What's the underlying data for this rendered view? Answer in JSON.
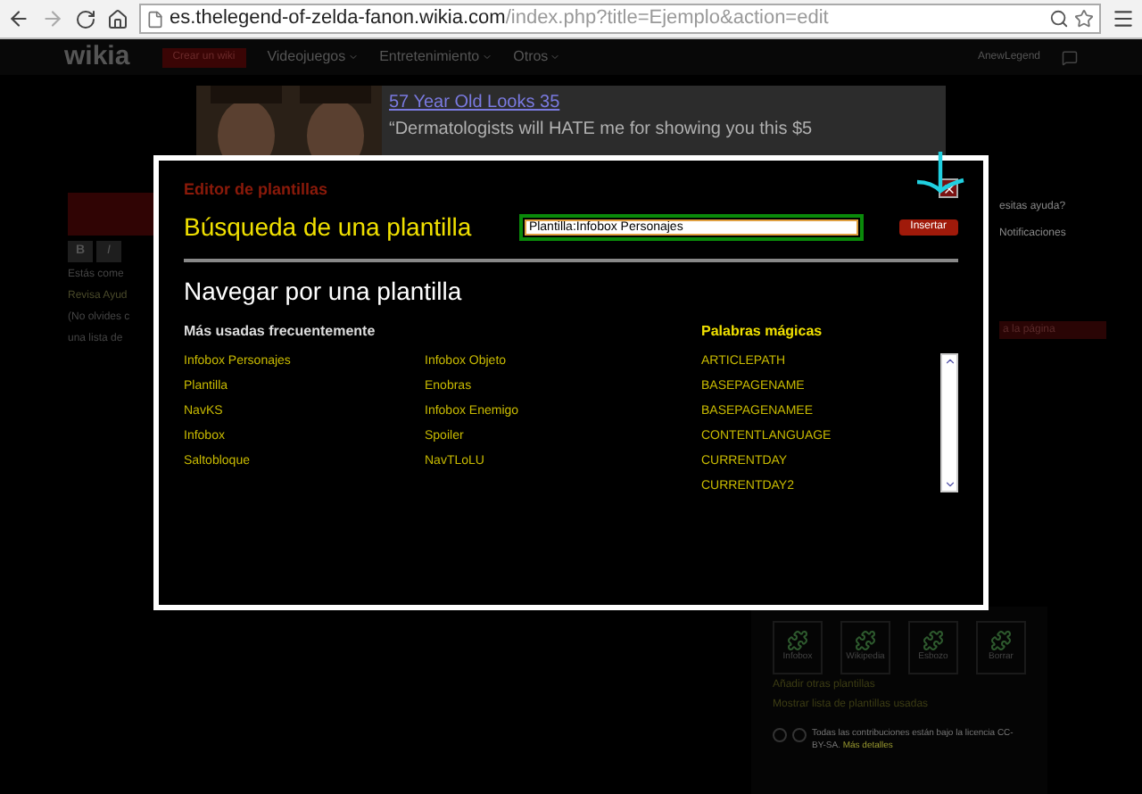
{
  "browser": {
    "url_host": "es.thelegend-of-zelda-fanon.wikia.com",
    "url_path": "/index.php?title=Ejemplo&action=edit"
  },
  "nav": {
    "logo": "wikia",
    "create": "Crear un wiki",
    "menus": [
      "Videojuegos",
      "Entretenimiento",
      "Otros"
    ],
    "user": "AnewLegend"
  },
  "ad": {
    "headline": "57 Year Old Looks 35",
    "text": "“Dermatologists will HATE me for showing you this $5"
  },
  "editor": {
    "toolbar": [
      "B",
      "I"
    ],
    "notes": [
      "Estás come",
      "Revisa Ayud",
      "(No olvides c",
      "una lista de"
    ]
  },
  "side": {
    "help": "esitas ayuda?",
    "notifications": "Notificaciones",
    "page_button": "a la página",
    "templates": [
      "Infobox",
      "Wikipedia",
      "Esbozo",
      "Borrar"
    ],
    "links": [
      "Añadir otras plantillas",
      "Mostrar lista de plantillas usadas"
    ],
    "license": "Todas las contribuciones están bajo la licencia CC-BY-SA.",
    "license_link": "Más detalles"
  },
  "dialog": {
    "title": "Editor de plantillas",
    "search_label": "Búsqueda de una plantilla",
    "search_value": "Plantilla:Infobox Personajes",
    "insert": "Insertar",
    "browse_title": "Navegar por una plantilla",
    "frequent_title": "Más usadas frecuentemente",
    "frequent": [
      [
        "Infobox Personajes",
        "Infobox Objeto"
      ],
      [
        "Plantilla",
        "Enobras"
      ],
      [
        "NavKS",
        "Infobox Enemigo"
      ],
      [
        "Infobox",
        "Spoiler"
      ],
      [
        "Saltobloque",
        "NavTLoLU"
      ]
    ],
    "magic_title": "Palabras mágicas",
    "magic": [
      "ARTICLEPATH",
      "BASEPAGENAME",
      "BASEPAGENAMEE",
      "CONTENTLANGUAGE",
      "CURRENTDAY",
      "CURRENTDAY2"
    ]
  }
}
